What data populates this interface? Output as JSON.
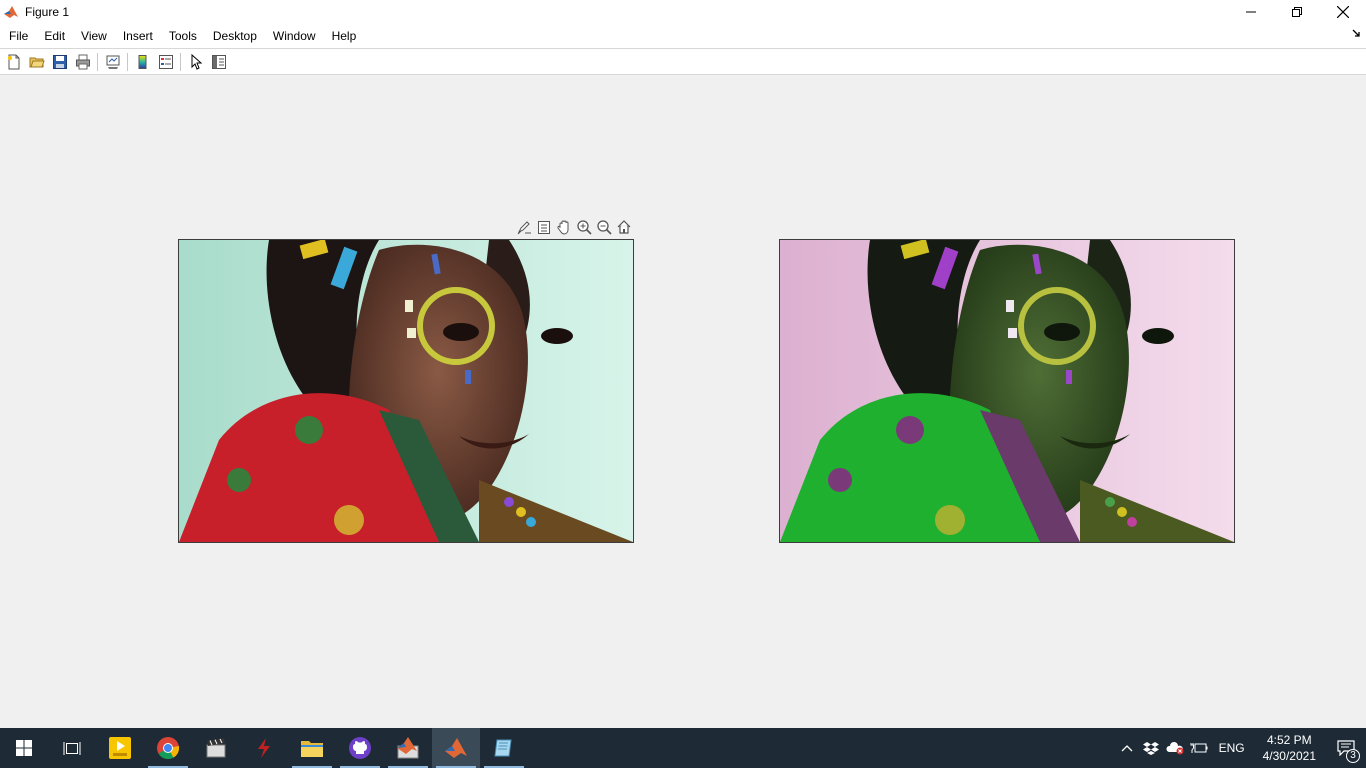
{
  "window": {
    "title": "Figure 1",
    "icon": "matlab-icon",
    "controls": [
      "minimize-icon",
      "restore-icon",
      "close-icon"
    ]
  },
  "menu": {
    "items": [
      "File",
      "Edit",
      "View",
      "Insert",
      "Tools",
      "Desktop",
      "Window",
      "Help"
    ]
  },
  "toolbar": {
    "buttons": [
      "new-figure-icon",
      "open-file-icon",
      "save-icon",
      "print-icon",
      "link-plot-icon",
      "insert-colorbar-icon",
      "insert-legend-icon",
      "edit-plot-icon",
      "open-property-inspector-icon"
    ]
  },
  "axes_toolbar": {
    "buttons": [
      "brush-icon",
      "data-tips-icon",
      "pan-icon",
      "zoom-in-icon",
      "zoom-out-icon",
      "restore-view-icon"
    ]
  },
  "figures": {
    "left": {
      "content": "original color photo",
      "tint": "#8fd5c4"
    },
    "right": {
      "content": "color-swapped photo",
      "tint": "#e8bfd8"
    }
  },
  "taskbar": {
    "apps": [
      "start-icon",
      "task-view-icon",
      "potplayer-icon",
      "chrome-icon",
      "video-editor-icon",
      "filezilla-icon",
      "file-explorer-icon",
      "github-desktop-icon",
      "matlab-installer-icon",
      "matlab-icon",
      "notepad-icon"
    ],
    "language": "ENG",
    "time": "4:52 PM",
    "date": "4/30/2021",
    "notification_count": "3"
  },
  "colors": {
    "taskbar_bg": "#1e2b36",
    "window_bg": "#f0f0f0",
    "matlab_orange": "#e16737"
  }
}
